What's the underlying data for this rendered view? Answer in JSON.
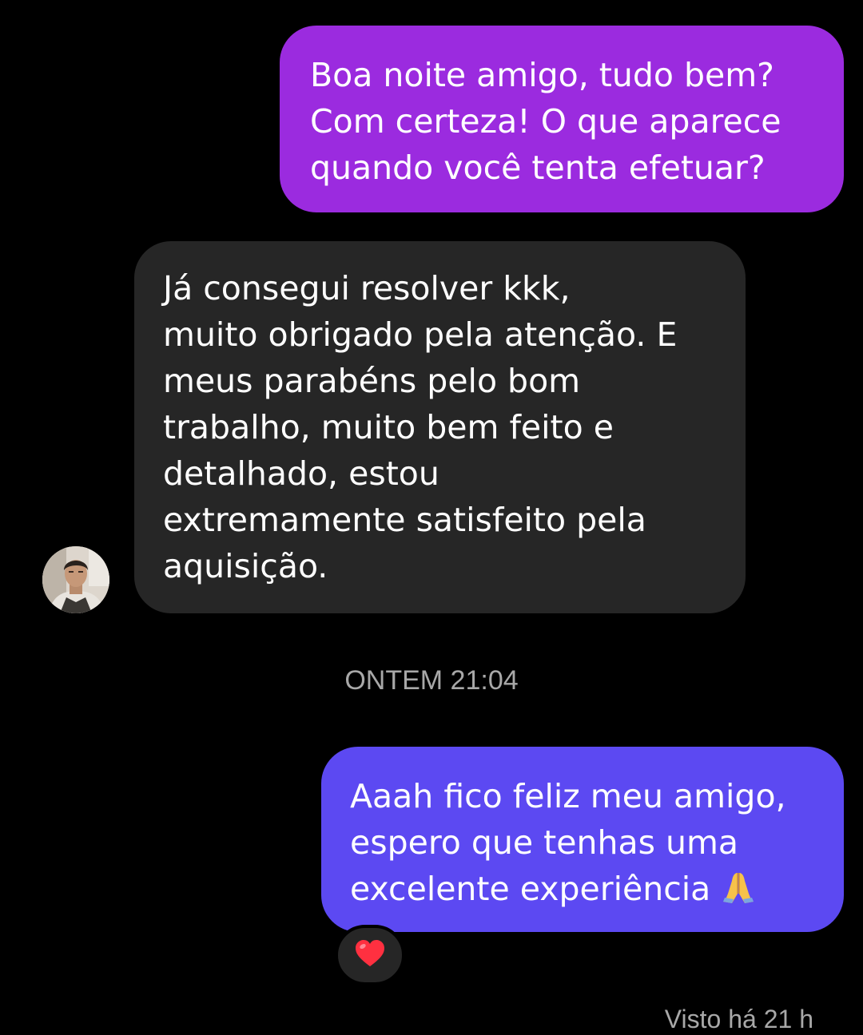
{
  "messages": [
    {
      "sender": "me",
      "lines": [
        "Boa noite amigo, tudo bem?",
        "Com certeza! O que aparece",
        "quando você tenta efetuar?"
      ]
    },
    {
      "sender": "contact",
      "lines": [
        "Já consegui resolver kkk,",
        "muito obrigado pela atenção. E",
        "meus parabéns pelo bom",
        "trabalho, muito bem feito e",
        "detalhado, estou",
        "extremamente satisfeito pela",
        "aquisição."
      ]
    },
    {
      "sender": "me",
      "lines": [
        "Aaah fico feliz meu amigo,",
        "espero que tenhas uma",
        "excelente experiência"
      ],
      "trailing_emoji": "folded-hands-icon",
      "reaction": "heart-icon"
    }
  ],
  "timestamp": "ONTEM 21:04",
  "seen_status": "Visto há 21 h",
  "colors": {
    "background": "#000000",
    "outgoing_purple": "#9b2bdf",
    "outgoing_blue": "#5c49f2",
    "incoming": "#262626",
    "meta_text": "#a8a8a8",
    "heart": "#ff3040"
  }
}
